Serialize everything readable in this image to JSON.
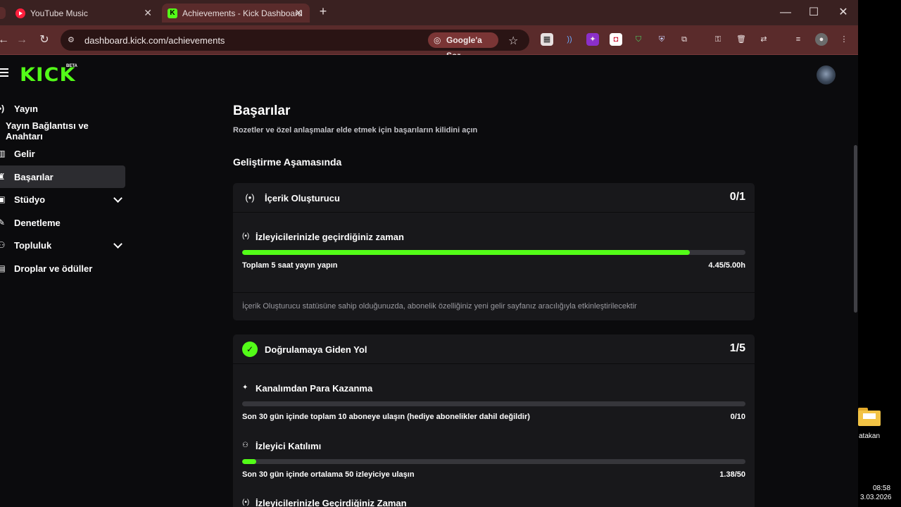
{
  "browser": {
    "tabs": [
      {
        "title": "YouTube Music"
      },
      {
        "title": "Achievements - Kick Dashboard"
      }
    ],
    "url": "dashboard.kick.com/achievements",
    "google_chip": "Google'a Sor"
  },
  "header": {
    "logo": "KICK",
    "beta": "BETA"
  },
  "sidebar": {
    "items": [
      {
        "label": "Yayın",
        "icon": "broadcast-icon"
      },
      {
        "label": "Yayın Bağlantısı ve Anahtarı",
        "icon": ""
      },
      {
        "label": "Gelir",
        "icon": "chart-icon"
      },
      {
        "label": "Başarılar",
        "icon": "trophy-icon",
        "active": true
      },
      {
        "label": "Stüdyo",
        "icon": "studio-icon",
        "expandable": true
      },
      {
        "label": "Denetleme",
        "icon": "wrench-icon"
      },
      {
        "label": "Topluluk",
        "icon": "people-icon",
        "expandable": true
      },
      {
        "label": "Droplar ve ödüller",
        "icon": "gift-icon"
      }
    ]
  },
  "main": {
    "title": "Başarılar",
    "subtitle": "Rozetler ve özel anlaşmalar elde etmek için başarıların kilidini açın",
    "section": "Geliştirme Aşamasında",
    "cards": [
      {
        "title": "İçerik Oluşturucu",
        "count": "0/1",
        "achievements": [
          {
            "title": "İzleyicilerinizle geçirdiğiniz zaman",
            "requirement": "Toplam 5 saat yayın yapın",
            "progress_text": "4.45/5.00h",
            "progress": 0.89
          }
        ],
        "footer": "İçerik Oluşturucu statüsüne sahip olduğunuzda, abonelik özelliğiniz yeni gelir sayfanız aracılığıyla etkinleştirilecektir"
      },
      {
        "title": "Doğrulamaya Giden Yol",
        "count": "1/5",
        "achievements": [
          {
            "title": "Kanalımdan Para Kazanma",
            "requirement": "Son 30 gün içinde toplam 10 aboneye ulaşın (hediye abonelikler dahil değildir)",
            "progress_text": "0/10",
            "progress": 0.0
          },
          {
            "title": "İzleyici Katılımı",
            "requirement": "Son 30 gün içinde ortalama 50 izleyiciye ulaşın",
            "progress_text": "1.38/50",
            "progress": 0.028
          },
          {
            "title": "İzleyicilerinizle Geçirdiğiniz Zaman",
            "requirement": "",
            "progress_text": "",
            "progress": null
          }
        ]
      }
    ]
  },
  "desktop": {
    "folder_label": "atakan",
    "time": "08:58",
    "date": "3.03.2026"
  },
  "colors": {
    "accent": "#53fc18",
    "tab_strip": "#3a2121",
    "toolbar": "#5a2b2b",
    "page_bg": "#0b0b0d",
    "card_bg": "#18181b"
  }
}
